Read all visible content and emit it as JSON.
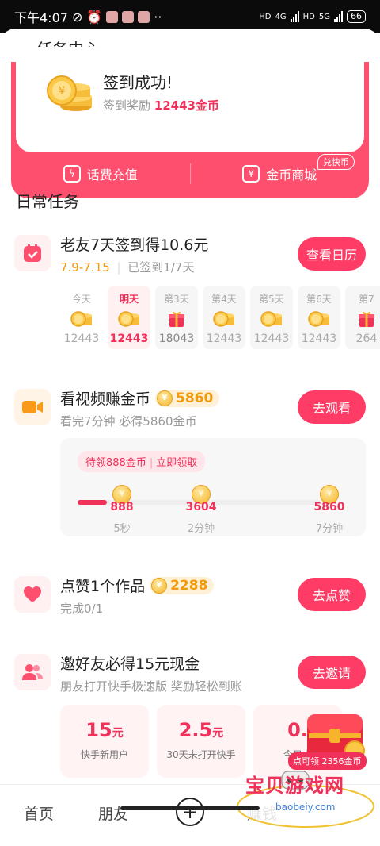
{
  "status_bar": {
    "time": "下午4:07",
    "net1": "4G",
    "net2": "5G",
    "hd": "HD",
    "battery": "66"
  },
  "header": {
    "title": "任务中心"
  },
  "sign_in": {
    "title": "签到成功!",
    "reward_prefix": "签到奖励",
    "reward_value": "12443金币"
  },
  "quick_actions": [
    {
      "label": "话费充值",
      "icon": "lightning-icon"
    },
    {
      "label": "金币商城",
      "icon": "yen-ticket-icon"
    }
  ],
  "exchange_badge": "兑快币",
  "daily_section_title": "日常任务",
  "task_checkin": {
    "title": "老友7天签到得10.6元",
    "date_range": "7.9-7.15",
    "progress_text": "已签到1/7天",
    "button": "查看日历",
    "days": [
      {
        "label": "今天",
        "value": "12443"
      },
      {
        "label": "明天",
        "value": "12443"
      },
      {
        "label": "第3天",
        "value": "18043"
      },
      {
        "label": "第4天",
        "value": "12443"
      },
      {
        "label": "第5天",
        "value": "12443"
      },
      {
        "label": "第6天",
        "value": "12443"
      },
      {
        "label": "第7",
        "value": "264"
      }
    ]
  },
  "task_video": {
    "title": "看视频赚金币",
    "coins": "5860",
    "subtitle": "看完7分钟 必得5860金币",
    "button": "去观看",
    "tag_pending": "待领888金币",
    "tag_action": "立即领取",
    "progress": 0.12,
    "milestones": [
      {
        "value": "888",
        "time": "5秒"
      },
      {
        "value": "3604",
        "time": "2分钟"
      },
      {
        "value": "5860",
        "time": "7分钟"
      }
    ]
  },
  "task_like": {
    "title": "点赞1个作品",
    "coins": "2288",
    "subtitle": "完成0/1",
    "button": "去点赞"
  },
  "task_invite": {
    "title": "邀好友必得15元现金",
    "subtitle": "朋友打开快手极速版 奖励轻松到账",
    "button": "去邀请",
    "cards": [
      {
        "value": "15",
        "unit": "元",
        "label": "快手新用户"
      },
      {
        "value": "2.5",
        "unit": "元",
        "label": "30天未打开快手"
      },
      {
        "value": "0.",
        "unit": "",
        "label": "今日未"
      }
    ]
  },
  "chest": {
    "label": "点可领 2356金币"
  },
  "tabbar": {
    "home": "首页",
    "friends": "朋友",
    "earn": "赚钱"
  },
  "watermark": {
    "text": "宝贝游戏网",
    "url": "baobeiy.com"
  },
  "colors": {
    "accent": "#fe3c66",
    "banner": "#fe4f6e",
    "gold": "#f5b52a"
  }
}
